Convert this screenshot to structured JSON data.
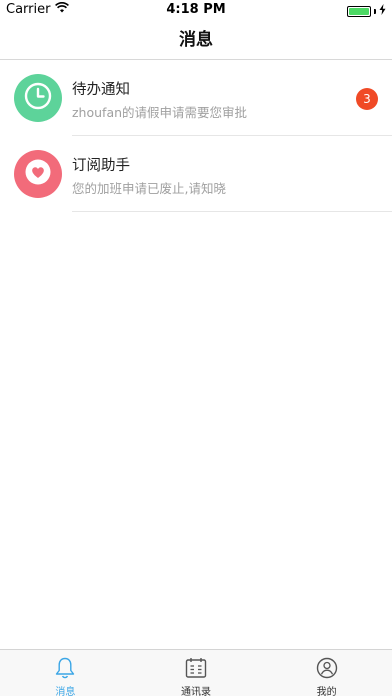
{
  "status_bar": {
    "carrier": "Carrier",
    "time": "4:18 PM",
    "battery_level": 1.0,
    "battery_color": "#4cd964",
    "icons": [
      "wifi-icon",
      "battery-icon",
      "charging-bolt-icon"
    ]
  },
  "nav": {
    "title": "消息"
  },
  "messages": [
    {
      "title": "待办通知",
      "subtitle": "zhoufan的请假申请需要您审批",
      "badge": "3",
      "icon": "clock-icon",
      "icon_color": "#5dd39a"
    },
    {
      "title": "订阅助手",
      "subtitle": "您的加班申请已废止,请知晓",
      "icon": "heart-icon",
      "icon_color": "#f26b7a"
    }
  ],
  "tabs": [
    {
      "label": "消息",
      "icon": "bell-icon",
      "active": true
    },
    {
      "label": "通讯录",
      "icon": "contacts-icon",
      "active": false
    },
    {
      "label": "我的",
      "icon": "user-icon",
      "active": false
    }
  ],
  "colors": {
    "accent": "#3ba6e6",
    "badge": "#f04a26"
  }
}
